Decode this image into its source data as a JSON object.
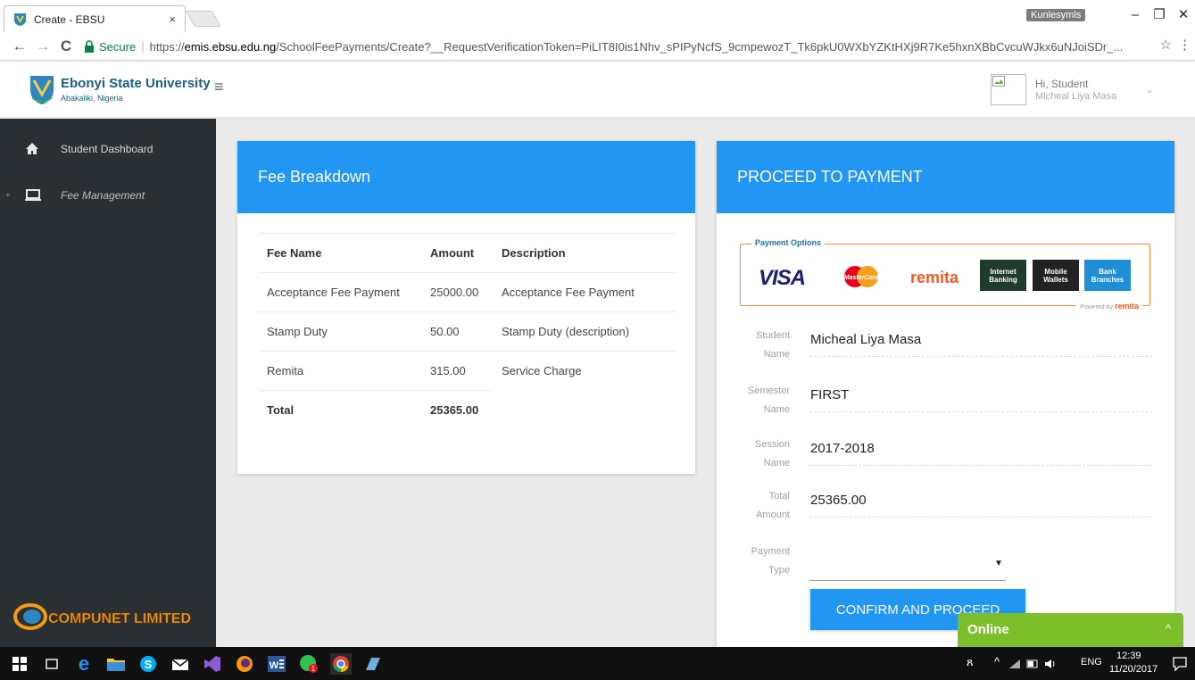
{
  "browser": {
    "tab_title": "Create - EBSU",
    "tab_close": "×",
    "profile_name": "Kunlesymls",
    "minimize": "–",
    "restore": "❐",
    "close": "✕",
    "back": "←",
    "forward": "→",
    "reload": "C",
    "secure_label": "Secure",
    "url_scheme": "https://",
    "url_host": "emis.ebsu.edu.ng",
    "url_path": "/SchoolFeePayments/Create?__RequestVerificationToken=PiLIT8I0is1Nhv_sPIPyNcfS_9cmpewozT_Tk6pkU0WXbYZKtHXj9R7Ke5hxnXBbCvcuWJkx6uNJoiSDr_...",
    "star": "☆",
    "menu": "⋮"
  },
  "header": {
    "brand_name": "Ebonyi State University",
    "brand_sub": "Abakaliki, Nigeria",
    "menu_icon": "≡",
    "user_greeting": "Hi, Student",
    "user_name": "Micheal Liya Masa",
    "user_chevron": "⌄"
  },
  "sidebar": {
    "items": [
      {
        "label": "Student Dashboard",
        "icon": "home-icon"
      },
      {
        "label": "Fee Management",
        "icon": "monitor-icon",
        "expander": "+"
      }
    ],
    "footer_logo": "COMPUNET LIMITED"
  },
  "fee_breakdown": {
    "title": "Fee Breakdown",
    "columns": [
      "Fee Name",
      "Amount",
      "Description"
    ],
    "rows": [
      {
        "name": "Acceptance Fee Payment",
        "amount": "25000.00",
        "description": "Acceptance Fee Payment"
      },
      {
        "name": "Stamp Duty",
        "amount": "50.00",
        "description": "Stamp Duty (description)"
      },
      {
        "name": "Remita",
        "amount": "315.00",
        "description": "Service Charge"
      }
    ],
    "total_label": "Total",
    "total_amount": "25365.00"
  },
  "payment": {
    "title": "PROCEED TO PAYMENT",
    "options_title": "Payment Options",
    "options": {
      "visa": "VISA",
      "mastercard": "MasterCard",
      "remita": "remita",
      "internet_banking": "Internet Banking",
      "mobile_wallets": "Mobile Wallets",
      "bank_branches": "Bank Branches"
    },
    "powered_by": "Powered by",
    "powered_brand": "remita",
    "fields": {
      "student_name_label": "Student Name",
      "student_name": "Micheal Liya Masa",
      "semester_label": "Semester Name",
      "semester": "FIRST",
      "session_label": "Session Name",
      "session": "2017-2018",
      "total_label": "Total Amount",
      "total": "25365.00",
      "payment_type_label": "Payment Type",
      "payment_type": "",
      "select_caret": "▼"
    },
    "confirm_label": "CONFIRM AND PROCEED"
  },
  "chat": {
    "label": "Online",
    "chevron": "^"
  },
  "taskbar": {
    "tray_people": "ጸ",
    "tray_up": "^",
    "tray_lang": "ENG",
    "clock_time": "12:39",
    "clock_date": "11/20/2017"
  },
  "colors": {
    "primary": "#2196f3",
    "sidebar": "#2a2f33",
    "online": "#7cbf2a",
    "secure": "#0b8043"
  }
}
